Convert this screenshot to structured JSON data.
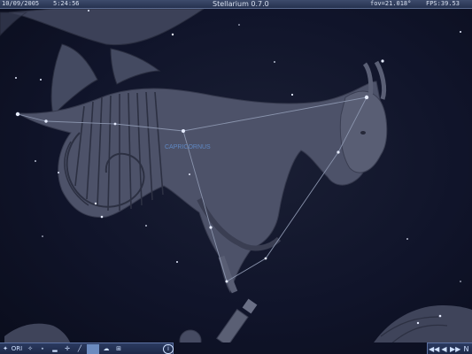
{
  "top_bar": {
    "date": "10/09/2005",
    "time": "5:24:56",
    "title": "Stellarium 0.7.0",
    "fov": "fov=21.018°",
    "fps": "FPS:39.53"
  },
  "sky": {
    "constellation_label": "CAPRICORNUS",
    "line_color": "#8a94ad",
    "art_color": "#4b5168",
    "label_color": "#5f88c4"
  },
  "bottom_toolbar": {
    "ori_label": "ORI",
    "info_label": "i",
    "icons": [
      "compass-icon",
      "ori-button",
      "telescope-icon",
      "star-icon",
      "landscape-icon",
      "cardinal-icon",
      "constellation-lines-icon",
      "constellation-art-icon",
      "atmosphere-icon",
      "grid-icon",
      "info-icon"
    ]
  },
  "nav_buttons": {
    "rewind": "◀◀",
    "back": "◀",
    "forward": "▶",
    "fast_forward": "▶▶",
    "north": "N"
  }
}
